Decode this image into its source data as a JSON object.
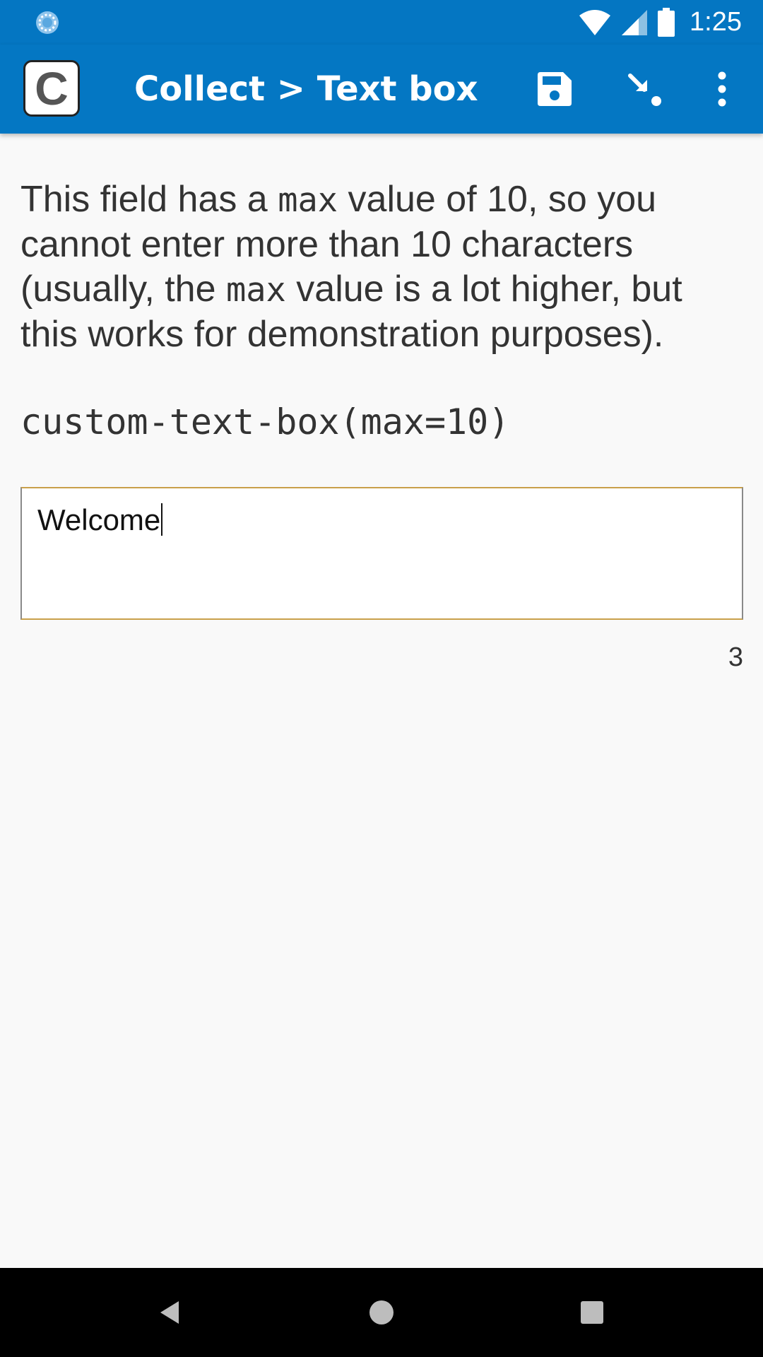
{
  "status_bar": {
    "time": "1:25",
    "icons": [
      "sync-icon",
      "wifi-icon",
      "cell-signal-icon",
      "battery-icon"
    ]
  },
  "app_bar": {
    "logo_letter": "C",
    "title": "Collect > Text box…",
    "actions": [
      "save-icon",
      "jump-to-icon",
      "more-options-icon"
    ],
    "color": "#0477c3"
  },
  "question": {
    "text_1": "This field has a ",
    "code_1": "max",
    "text_2": " value of 10, so you cannot enter more than 10 characters (usually, the ",
    "code_2": "max",
    "text_3": " value is a lot higher, but this works for demonstration purposes).",
    "appearance": "custom-text-box(max=10)"
  },
  "answer": {
    "value": "Welcome",
    "remaining_count": "3"
  },
  "nav_bar": {
    "buttons": [
      "back-icon",
      "home-icon",
      "recents-icon"
    ]
  }
}
